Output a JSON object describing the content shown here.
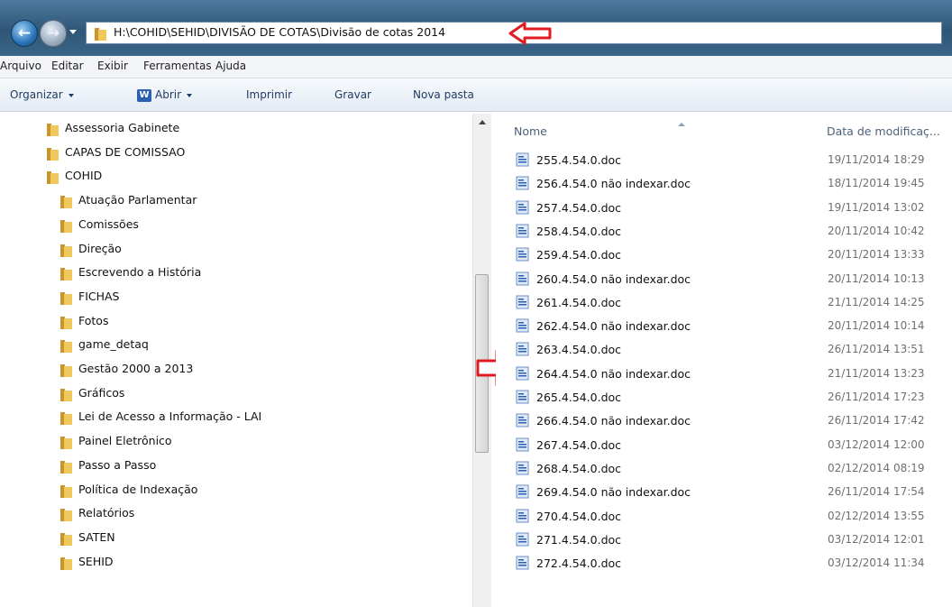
{
  "address": {
    "path": "H:\\COHID\\SEHID\\DIVISÃO DE COTAS\\Divisão de cotas 2014"
  },
  "menu": [
    "Arquivo",
    "Editar",
    "Exibir",
    "Ferramentas",
    "Ajuda"
  ],
  "toolbar": {
    "organize": "Organizar",
    "open": "Abrir",
    "print": "Imprimir",
    "burn": "Gravar",
    "new_folder": "Nova pasta"
  },
  "tree": [
    {
      "label": "Assessoria Gabinete",
      "level": 0
    },
    {
      "label": "CAPAS DE COMISSAO",
      "level": 0
    },
    {
      "label": "COHID",
      "level": 0
    },
    {
      "label": "Atuação Parlamentar",
      "level": 1
    },
    {
      "label": "Comissões",
      "level": 1
    },
    {
      "label": "Direção",
      "level": 1
    },
    {
      "label": "Escrevendo a História",
      "level": 1
    },
    {
      "label": "FICHAS",
      "level": 1
    },
    {
      "label": "Fotos",
      "level": 1
    },
    {
      "label": "game_detaq",
      "level": 1
    },
    {
      "label": "Gestão 2000 a 2013",
      "level": 1
    },
    {
      "label": "Gráficos",
      "level": 1
    },
    {
      "label": "Lei de Acesso a Informação - LAI",
      "level": 1
    },
    {
      "label": "Painel Eletrônico",
      "level": 1
    },
    {
      "label": "Passo a Passo",
      "level": 1
    },
    {
      "label": "Política de Indexação",
      "level": 1
    },
    {
      "label": "Relatórios",
      "level": 1
    },
    {
      "label": "SATEN",
      "level": 1
    },
    {
      "label": "SEHID",
      "level": 1
    }
  ],
  "columns": {
    "name": "Nome",
    "date": "Data de modificaç..."
  },
  "files": [
    {
      "name": "255.4.54.0.doc",
      "date": "19/11/2014 18:29"
    },
    {
      "name": "256.4.54.0 não indexar.doc",
      "date": "18/11/2014 19:45"
    },
    {
      "name": "257.4.54.0.doc",
      "date": "19/11/2014 13:02"
    },
    {
      "name": "258.4.54.0.doc",
      "date": "20/11/2014 10:42"
    },
    {
      "name": "259.4.54.0.doc",
      "date": "20/11/2014 13:33"
    },
    {
      "name": "260.4.54.0 não indexar.doc",
      "date": "20/11/2014 10:13"
    },
    {
      "name": "261.4.54.0.doc",
      "date": "21/11/2014 14:25"
    },
    {
      "name": "262.4.54.0 não indexar.doc",
      "date": "20/11/2014 10:14"
    },
    {
      "name": "263.4.54.0.doc",
      "date": "26/11/2014 13:51"
    },
    {
      "name": "264.4.54.0 não indexar.doc",
      "date": "21/11/2014 13:23"
    },
    {
      "name": "265.4.54.0.doc",
      "date": "26/11/2014 17:23"
    },
    {
      "name": "266.4.54.0 não indexar.doc",
      "date": "26/11/2014 17:42"
    },
    {
      "name": "267.4.54.0.doc",
      "date": "03/12/2014 12:00"
    },
    {
      "name": "268.4.54.0.doc",
      "date": "02/12/2014 08:19"
    },
    {
      "name": "269.4.54.0 não indexar.doc",
      "date": "26/11/2014 17:54"
    },
    {
      "name": "270.4.54.0.doc",
      "date": "02/12/2014 13:55"
    },
    {
      "name": "271.4.54.0.doc",
      "date": "03/12/2014 12:01"
    },
    {
      "name": "272.4.54.0.doc",
      "date": "03/12/2014 11:34"
    }
  ],
  "colors": {
    "annotation_arrow": "#e11b22",
    "folder": "#e8b84a"
  },
  "icons": [
    "back-arrow-icon",
    "forward-arrow-icon",
    "folder-icon",
    "word-icon",
    "doc-file-icon",
    "annotation-arrow-icon"
  ]
}
